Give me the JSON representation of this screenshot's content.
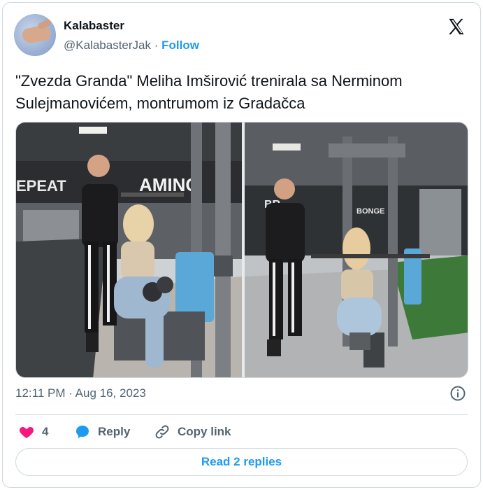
{
  "author": {
    "name": "Kalabaster",
    "handle": "@KalabasterJak",
    "separator": " · ",
    "follow_label": "Follow"
  },
  "tweet": {
    "text": "\"Zvezda Granda\" Meliha Imširović trenirala sa Nerminom Sulejmanovićem, montrumom iz Gradačca",
    "timestamp": "12:11 PM · Aug 16, 2023"
  },
  "media": {
    "left_photo": {
      "wall_text_1": "EPEAT",
      "wall_text_2": "AMINO"
    },
    "right_photo": {
      "wall_text_1": "BR",
      "wall_text_2": "BONGE"
    }
  },
  "actions": {
    "like_count": "4",
    "reply_label": "Reply",
    "copy_label": "Copy link"
  },
  "read_replies_label": "Read 2 replies",
  "colors": {
    "accent": "#1d9bf0",
    "like": "#f91880",
    "muted": "#536471",
    "border": "#cfd9de"
  },
  "icons": [
    "x-logo-icon",
    "info-icon",
    "heart-icon",
    "reply-bubble-icon",
    "link-icon"
  ]
}
